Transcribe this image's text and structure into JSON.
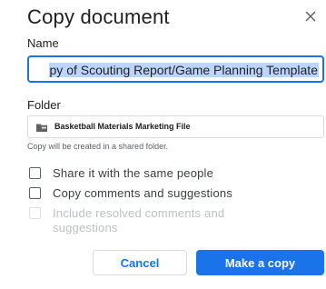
{
  "dialog": {
    "title": "Copy document",
    "close_icon": "close-icon"
  },
  "name_field": {
    "label": "Name",
    "value": "Copy of Scouting Report/Game Planning Template",
    "visible_value": "py of Scouting Report/Game Planning Template"
  },
  "folder_field": {
    "label": "Folder",
    "icon": "shared-folder-icon",
    "value": "Basketball Materials Marketing File",
    "note": "Copy will be created in a shared folder."
  },
  "options": [
    {
      "label": "Share it with the same people",
      "checked": false,
      "disabled": false
    },
    {
      "label": "Copy comments and suggestions",
      "checked": false,
      "disabled": false
    },
    {
      "label": "Include resolved comments and suggestions",
      "checked": false,
      "disabled": true
    }
  ],
  "buttons": {
    "cancel": "Cancel",
    "make_copy": "Make a copy"
  },
  "colors": {
    "accent": "#1a73e8",
    "selection": "#bcd6fb"
  }
}
